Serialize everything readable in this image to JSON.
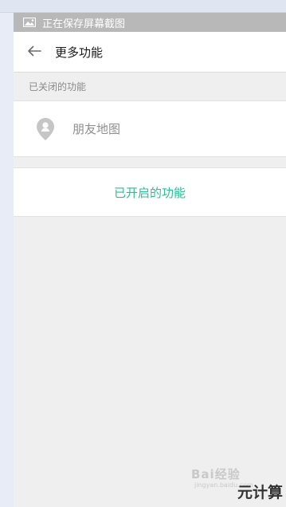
{
  "status_bar": {
    "text": "正在保存屏幕截图",
    "icon": "image-icon"
  },
  "header": {
    "title": "更多功能",
    "back_icon": "back-arrow-icon"
  },
  "closed_section": {
    "label": "已关闭的功能",
    "items": [
      {
        "label": "朋友地图",
        "icon": "location-pin-icon"
      }
    ]
  },
  "enabled_section": {
    "label": "已开启的功能",
    "color": "#2bbf94"
  },
  "watermark": {
    "text": "Bai经验",
    "sub": "jingyan.baidu.com",
    "brand": "元计算"
  }
}
